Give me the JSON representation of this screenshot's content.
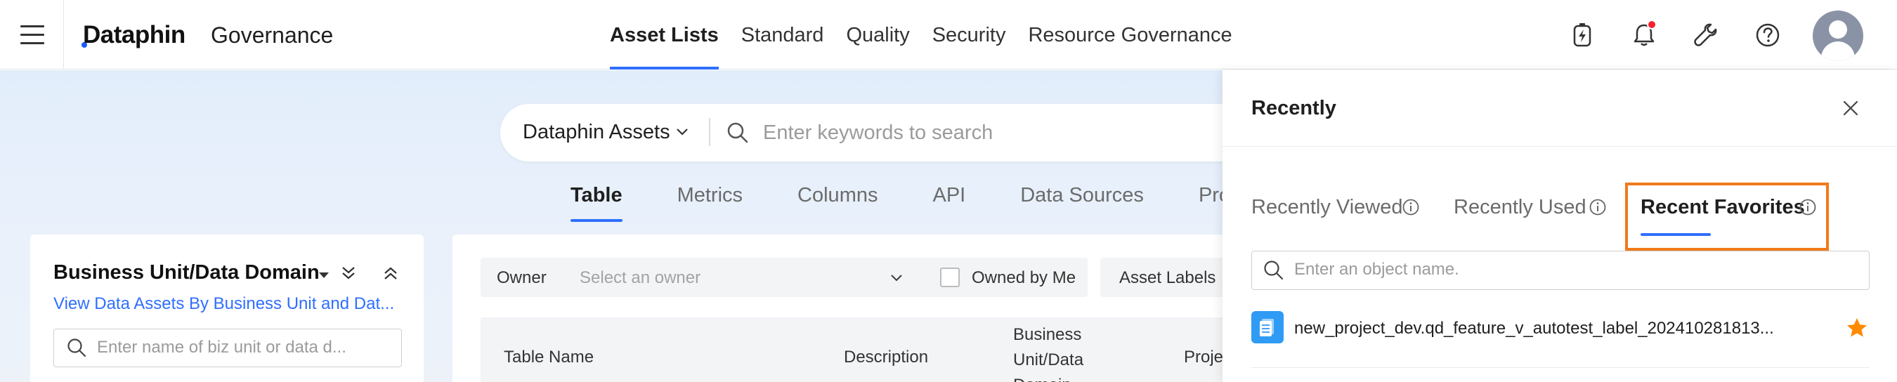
{
  "header": {
    "brand": "Dataphin",
    "product": "Governance",
    "nav": [
      {
        "label": "Asset Lists",
        "active": true
      },
      {
        "label": "Standard",
        "active": false
      },
      {
        "label": "Quality",
        "active": false
      },
      {
        "label": "Security",
        "active": false
      },
      {
        "label": "Resource Governance",
        "active": false
      }
    ],
    "icons": [
      "lightning-icon",
      "bell-icon",
      "wrench-icon",
      "help-icon",
      "avatar"
    ]
  },
  "search": {
    "scope": "Dataphin Assets",
    "placeholder": "Enter keywords to search"
  },
  "tabs": [
    {
      "label": "Table",
      "active": true
    },
    {
      "label": "Metrics",
      "active": false
    },
    {
      "label": "Columns",
      "active": false
    },
    {
      "label": "API",
      "active": false
    },
    {
      "label": "Data Sources",
      "active": false
    },
    {
      "label": "Project",
      "active": false
    }
  ],
  "left_panel": {
    "title": "Business Unit/Data Domain",
    "link": "View Data Assets By Business Unit and Dat...",
    "search_placeholder": "Enter name of biz unit or data d..."
  },
  "filters": {
    "owner_label": "Owner",
    "owner_placeholder": "Select an owner",
    "owned_by_me": "Owned by Me",
    "asset_labels": "Asset Labels"
  },
  "table": {
    "columns": [
      "Table Name",
      "Description",
      "Business Unit/Data Domain",
      "Proje"
    ]
  },
  "recently": {
    "title": "Recently",
    "tabs": [
      {
        "label": "Recently Viewed",
        "active": false
      },
      {
        "label": "Recently Used",
        "active": false
      },
      {
        "label": "Recent Favorites",
        "active": true
      }
    ],
    "search_placeholder": "Enter an object name.",
    "items": [
      {
        "name": "new_project_dev.qd_feature_v_autotest_label_202410281813...",
        "favorited": true
      }
    ]
  },
  "colors": {
    "accent": "#2f6fff",
    "highlight": "#f07a1a",
    "star": "#ff8a00",
    "notification": "#f5222d"
  }
}
